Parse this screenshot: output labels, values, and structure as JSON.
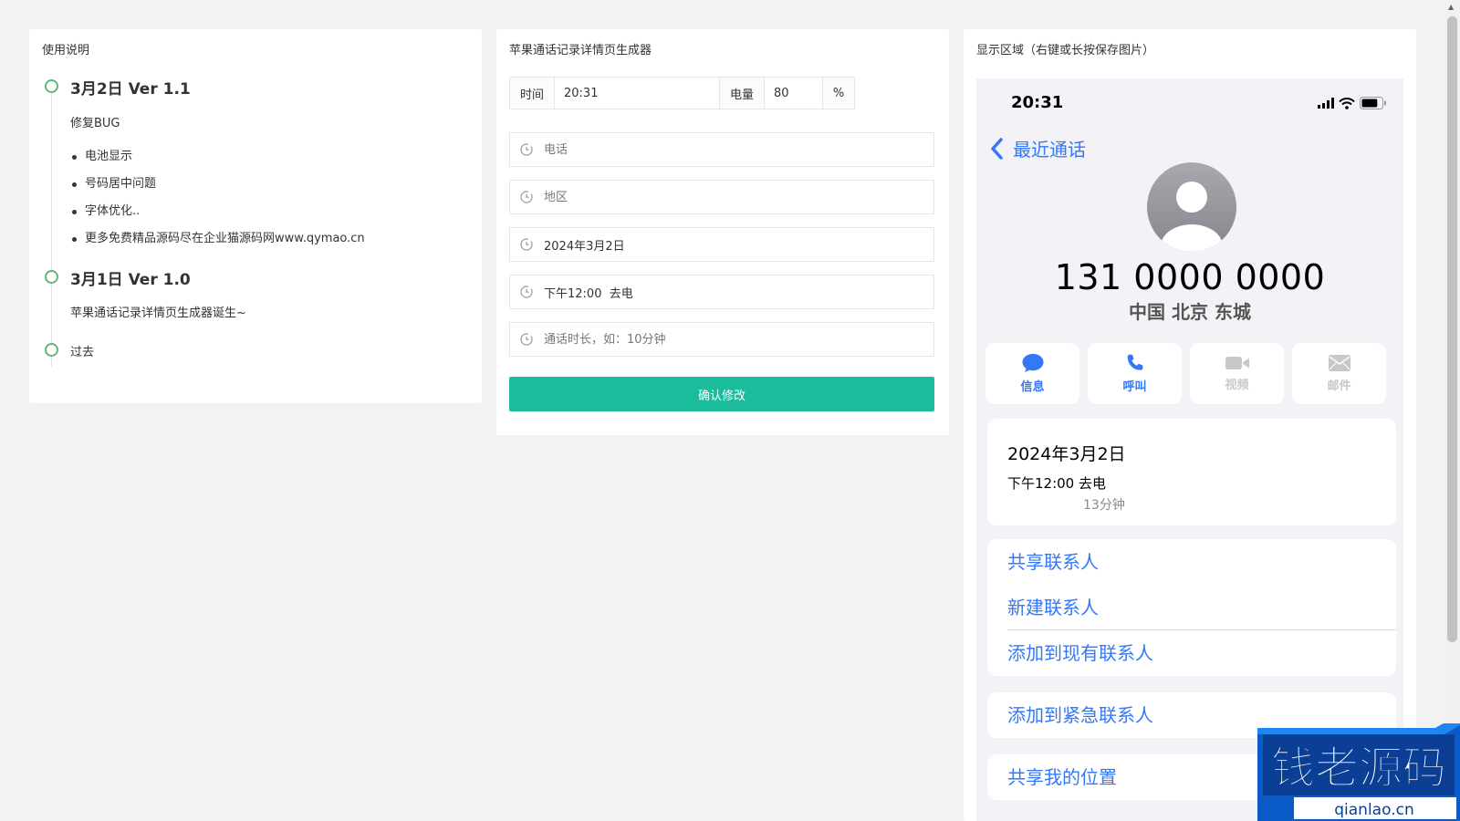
{
  "left_panel": {
    "title": "使用说明",
    "entries": [
      {
        "title": "3月2日 Ver 1.1",
        "subtitle": "修复BUG",
        "items": [
          "电池显示",
          "号码居中问题",
          "字体优化..",
          "更多免费精品源码尽在企业猫源码网www.qymao.cn"
        ]
      },
      {
        "title": "3月1日 Ver 1.0",
        "subtitle": "苹果通话记录详情页生成器诞生~"
      },
      {
        "title": "过去"
      }
    ]
  },
  "middle_panel": {
    "title": "苹果通话记录详情页生成器",
    "time_label": "时间",
    "time_value": "20:31",
    "battery_label": "电量",
    "battery_value": "80",
    "battery_unit": "%",
    "phone_placeholder": "电话",
    "region_placeholder": "地区",
    "date_value": "2024年3月2日",
    "call_time_value": "下午12:00  去电",
    "duration_placeholder": "通话时长，如：10分钟",
    "confirm_label": "确认修改"
  },
  "right_panel": {
    "title": "显示区域（右键或长按保存图片）",
    "phone": {
      "status_time": "20:31",
      "battery_percent": 80,
      "back_label": "最近通话",
      "number": "131 0000 0000",
      "region": "中国 北京 东城",
      "actions": [
        {
          "label": "信息",
          "icon": "message-bubble-icon",
          "enabled": true
        },
        {
          "label": "呼叫",
          "icon": "phone-icon",
          "enabled": true
        },
        {
          "label": "视频",
          "icon": "video-camera-icon",
          "enabled": false
        },
        {
          "label": "邮件",
          "icon": "mail-icon",
          "enabled": false
        }
      ],
      "call_date": "2024年3月2日",
      "call_time": "下午12:00  去电",
      "call_duration": "13分钟",
      "menu_group1": [
        "共享联系人",
        "新建联系人",
        "添加到现有联系人"
      ],
      "menu_group2": [
        "添加到紧急联系人"
      ],
      "menu_group3": [
        "共享我的位置"
      ]
    }
  },
  "watermark": {
    "text": "钱老源码",
    "domain": "qianlao.cn"
  },
  "colors": {
    "accent": "#1abc9c",
    "ios_blue": "#3478f6",
    "timeline": "#5fb878"
  }
}
